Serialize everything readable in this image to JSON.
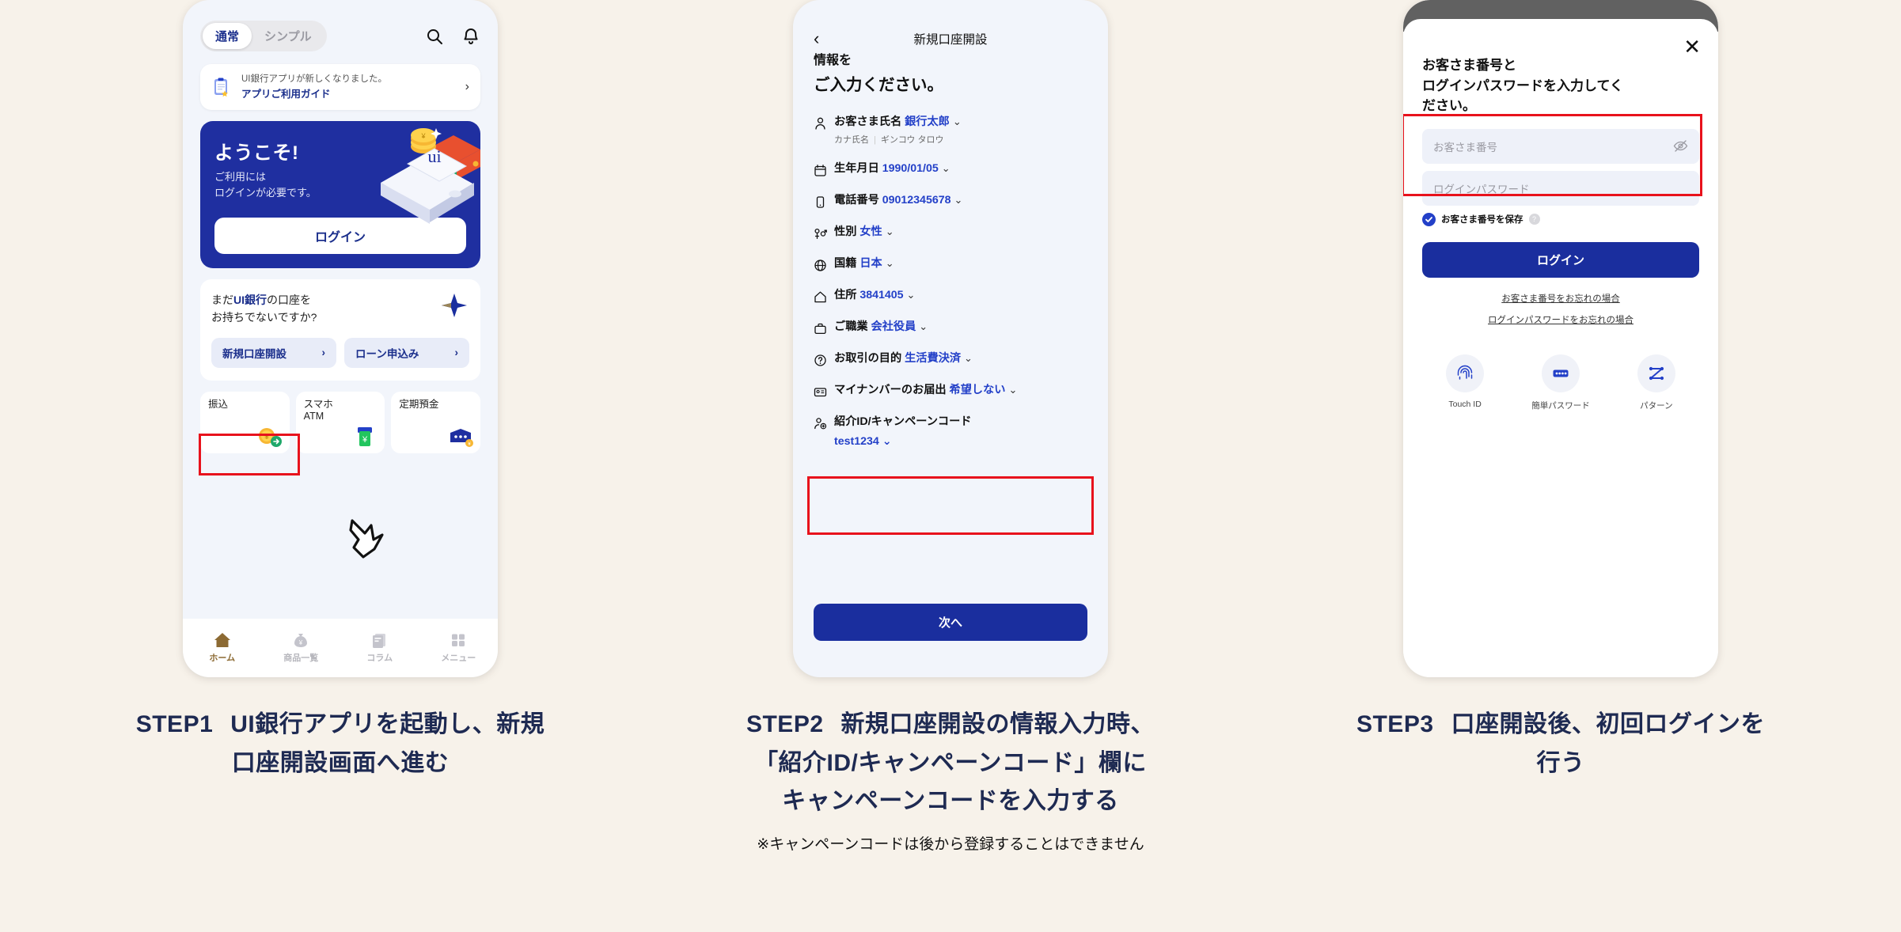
{
  "background_color": "#F7F2EA",
  "accent_navy": "#1A2E9E",
  "accent_blue": "#2340C8",
  "highlight_red": "#E8121C",
  "step1": {
    "segmented": {
      "options": [
        "通常",
        "シンプル"
      ],
      "selected": "通常"
    },
    "icons": {
      "search": "search-icon",
      "bell": "bell-icon"
    },
    "guide_card": {
      "line1": "UI銀行アプリが新しくなりました。",
      "line2": "アプリご利用ガイド",
      "chevron": "›"
    },
    "welcome": {
      "title": "ようこそ!",
      "sub_line1": "ご利用には",
      "sub_line2": "ログインが必要です。",
      "button": "ログイン"
    },
    "open_card": {
      "text_line1_a": "まだ",
      "text_line1_b": "UI銀行",
      "text_line1_c": "の口座を",
      "text_line2": "お持ちでないですか?",
      "buttons": [
        "新規口座開設",
        "ローン申込み"
      ],
      "highlighted_button": "新規口座開設"
    },
    "tiles": [
      {
        "label": "振込",
        "icon": "coin-arrow-icon"
      },
      {
        "label": "スマホ\nATM",
        "icon": "atm-icon"
      },
      {
        "label": "定期預金",
        "icon": "wallet-icon"
      }
    ],
    "tabbar": [
      {
        "label": "ホーム",
        "icon": "home-icon",
        "active": true
      },
      {
        "label": "商品一覧",
        "icon": "money-bag-icon",
        "active": false
      },
      {
        "label": "コラム",
        "icon": "document-icon",
        "active": false
      },
      {
        "label": "メニュー",
        "icon": "grid-icon",
        "active": false
      }
    ]
  },
  "step2": {
    "nav_back": "‹",
    "nav_title": "新規口座開設",
    "heading_line1": "情報を",
    "heading_line2": "ご入力ください。",
    "rows": [
      {
        "icon": "person-icon",
        "label": "お客さま氏名",
        "value": "銀行太郎",
        "chevron": "⌄",
        "kana_label": "カナ氏名",
        "kana_value": "ギンコウ タロウ"
      },
      {
        "icon": "calendar-icon",
        "label": "生年月日",
        "value": "1990/01/05",
        "chevron": "⌄"
      },
      {
        "icon": "phone-icon",
        "label": "電話番号",
        "value": "09012345678",
        "chevron": "⌄"
      },
      {
        "icon": "gender-icon",
        "label": "性別",
        "value": "女性",
        "chevron": "⌄"
      },
      {
        "icon": "globe-icon",
        "label": "国籍",
        "value": "日本",
        "chevron": "⌄"
      },
      {
        "icon": "home-outline-icon",
        "label": "住所",
        "value": "3841405",
        "chevron": "⌄"
      },
      {
        "icon": "briefcase-icon",
        "label": "ご職業",
        "value": "会社役員",
        "chevron": "⌄"
      },
      {
        "icon": "question-icon",
        "label": "お取引の目的",
        "value": "生活費決済",
        "chevron": "⌄"
      },
      {
        "icon": "id-card-icon",
        "label": "マイナンバーのお届出",
        "value": "希望しない",
        "chevron": "⌄"
      }
    ],
    "campaign_row": {
      "icon": "person-add-icon",
      "label": "紹介ID/キャンペーンコード",
      "value": "test1234",
      "chevron": "⌄",
      "highlighted": true
    },
    "next_button": "次へ"
  },
  "step3": {
    "close": "✕",
    "heading_line1": "お客さま番号と",
    "heading_line2": "ログインパスワードを入力してく",
    "heading_line3": "ださい。",
    "fields": [
      {
        "placeholder": "お客さま番号",
        "icon": "eye-off-icon"
      },
      {
        "placeholder": "ログインパスワード",
        "icon": ""
      }
    ],
    "save_checkbox": {
      "label": "お客さま番号を保存",
      "checked": true,
      "help": "?"
    },
    "login_button": "ログイン",
    "links": [
      "お客さま番号をお忘れの場合",
      "ログインパスワードをお忘れの場合"
    ],
    "bio_options": [
      {
        "label": "Touch ID",
        "icon": "fingerprint-icon"
      },
      {
        "label": "簡単パスワード",
        "icon": "dots-password-icon"
      },
      {
        "label": "パターン",
        "icon": "pattern-icon"
      }
    ]
  },
  "captions": [
    {
      "num": "STEP1",
      "line1": "UI銀行アプリを起動し、新規",
      "line2": "口座開設画面へ進む",
      "note": ""
    },
    {
      "num": "STEP2",
      "line1": "新規口座開設の情報入力時、",
      "line2": "「紹介ID/キャンペーンコード」欄に",
      "line3": "キャンペーンコードを入力する",
      "note": "※キャンペーンコードは後から登録することはできません"
    },
    {
      "num": "STEP3",
      "line1": "口座開設後、初回ログインを",
      "line2": "行う",
      "note": ""
    }
  ]
}
